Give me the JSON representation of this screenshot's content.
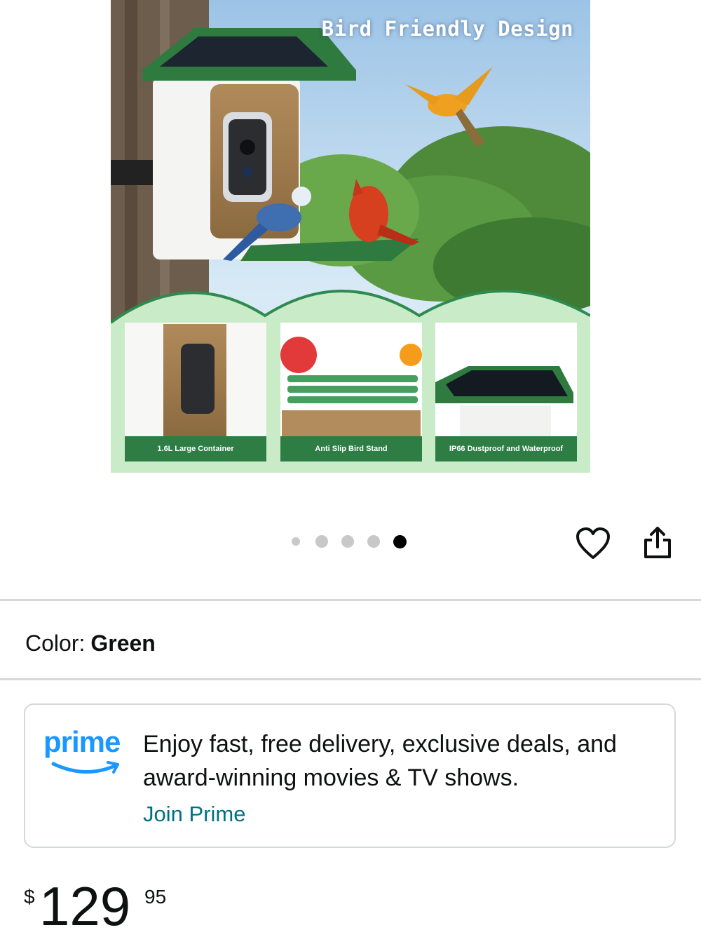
{
  "product_image": {
    "title": "Bird Friendly Design",
    "captions": [
      "1.6L Large Container",
      "Anti Slip Bird Stand",
      "IP66 Dustproof and Waterproof"
    ],
    "colors": {
      "feeder_green": "#2f7a3f",
      "caption_green": "#2e7d45",
      "sky": "#a9cde8",
      "panel_mint": "#c9ebc8"
    }
  },
  "carousel": {
    "total": 5,
    "active_index": 5
  },
  "actions": {
    "favorite_icon": "heart-icon",
    "share_icon": "share-icon"
  },
  "variant": {
    "label": "Color:",
    "value": "Green"
  },
  "prime": {
    "logo_text": "prime",
    "message": "Enjoy fast, free delivery, exclusive deals, and award-winning movies & TV shows.",
    "join_label": "Join Prime",
    "brand_color": "#1a98ff",
    "link_color": "#007185"
  },
  "price": {
    "symbol": "$",
    "whole": "129",
    "fraction": "95"
  }
}
